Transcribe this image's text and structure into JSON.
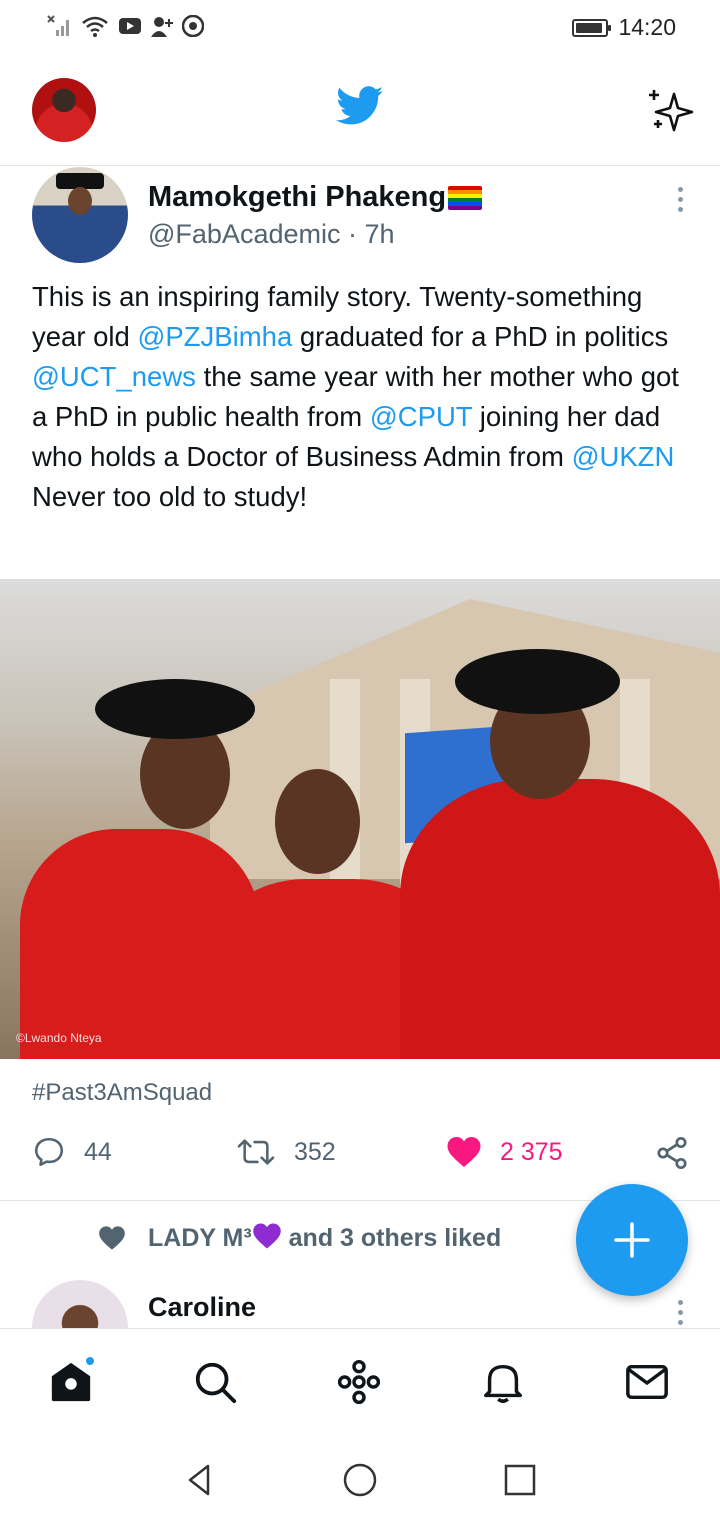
{
  "status_bar": {
    "time": "14:20",
    "icons": [
      "no-signal-icon",
      "wifi-icon",
      "youtube-icon",
      "add-user-icon",
      "chrome-icon",
      "battery-icon"
    ]
  },
  "header": {
    "logo": "twitter-bird-icon",
    "right_icon": "sparkle-icon"
  },
  "tweet": {
    "author_name": "Mamokgethi Phakeng",
    "author_flag": "rainbow-flag-emoji",
    "handle": "@FabAcademic",
    "separator": "·",
    "time": "7h",
    "text_parts": [
      {
        "t": "This is an inspiring family story. Twenty-something year old ",
        "mention": false
      },
      {
        "t": "@PZJBimha",
        "mention": true
      },
      {
        "t": " graduated for a PhD in politics ",
        "mention": false
      },
      {
        "t": "@UCT_news",
        "mention": true
      },
      {
        "t": " the same year with her mother who got a PhD in public health from ",
        "mention": false
      },
      {
        "t": "@CPUT",
        "mention": true
      },
      {
        "t": " joining her dad who holds a Doctor of Business Admin from ",
        "mention": false
      },
      {
        "t": "@UKZN",
        "mention": true
      },
      {
        "t": " Never too old to study!",
        "mention": false
      }
    ],
    "media_credit": "©Lwando Nteya",
    "hashtag": "#Past3AmSquad",
    "actions": {
      "replies": "44",
      "retweets": "352",
      "likes": "2 375"
    }
  },
  "next_item": {
    "liked_by_name": "LADY M³",
    "liked_by_rest": "and 3 others liked",
    "author_name": "Caroline"
  },
  "colors": {
    "accent": "#1d9bf0",
    "like": "#f91880",
    "muted": "#536471"
  }
}
